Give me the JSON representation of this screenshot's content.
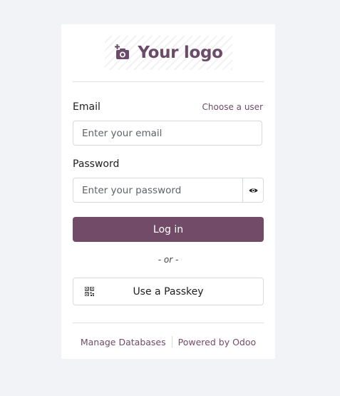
{
  "logo": {
    "text": "Your logo",
    "icon": "camera-plus-icon",
    "color": "#6b4b6a"
  },
  "form": {
    "email_label": "Email",
    "choose_user_link": "Choose a user",
    "email_placeholder": "Enter your email",
    "password_label": "Password",
    "password_placeholder": "Enter your password",
    "show_password_icon": "eye-icon",
    "login_button": "Log in",
    "or_text": "- or -",
    "passkey_button": "Use a Passkey",
    "passkey_icon": "qr-code-icon"
  },
  "footer": {
    "manage_databases": "Manage Databases",
    "powered_by": "Powered by Odoo"
  },
  "colors": {
    "primary": "#714b67",
    "background": "#f2f3f6",
    "card": "#ffffff"
  }
}
